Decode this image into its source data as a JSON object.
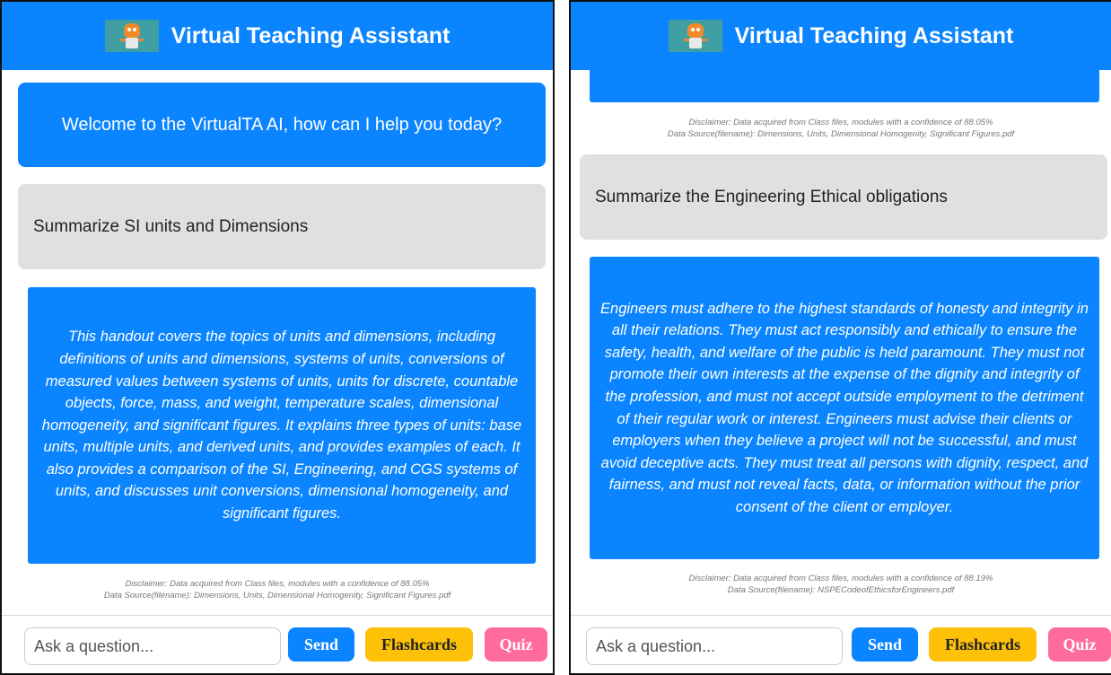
{
  "app": {
    "title": "Virtual Teaching Assistant"
  },
  "left": {
    "welcome": "Welcome to the VirtualTA AI, how can I help you today?",
    "user_message": "Summarize SI units and Dimensions",
    "bot_answer": "This handout covers the topics of units and dimensions, including definitions of units and dimensions, systems of units, conversions of measured values between systems of units, units for discrete, countable objects, force, mass, and weight, temperature scales, dimensional homogeneity, and significant figures. It explains three types of units: base units, multiple units, and derived units, and provides examples of each. It also provides a comparison of the SI, Engineering, and CGS systems of units, and discusses unit conversions, dimensional homogeneity, and significant figures.",
    "disclaimer": "Disclaimer: Data acquired from Class files, modules with a confidence of 88.05%",
    "source": "Data Source(filename): Dimensions, Units, Dimensional Homogenity, Significant Figures.pdf"
  },
  "right": {
    "prev_disclaimer": "Disclaimer: Data acquired from Class files, modules with a confidence of 88.05%",
    "prev_source": "Data Source(filename): Dimensions, Units, Dimensional Homogenity, Significant Figures.pdf",
    "user_message": "Summarize the Engineering Ethical obligations",
    "bot_answer": "Engineers must adhere to the highest standards of honesty and integrity in all their relations. They must act responsibly and ethically to ensure the safety, health, and welfare of the public is held paramount. They must not promote their own interests at the expense of the dignity and integrity of the profession, and must not accept outside employment to the detriment of their regular work or interest. Engineers must advise their clients or employers when they believe a project will not be successful, and must avoid deceptive acts. They must treat all persons with dignity, respect, and fairness, and must not reveal facts, data, or information without the prior consent of the client or employer.",
    "disclaimer": "Disclaimer: Data acquired from Class files, modules with a confidence of 88.19%",
    "source": "Data Source(filename): NSPECodeofEthicsforEngineers.pdf"
  },
  "input": {
    "placeholder": "Ask a question...",
    "send_label": "Send",
    "flashcards_label": "Flashcards",
    "quiz_label": "Quiz"
  },
  "colors": {
    "primary": "#0a84ff",
    "user_bubble": "#e0e0e0",
    "flashcards": "#ffc107",
    "quiz": "#ff6b9d"
  },
  "icons": {
    "logo": "robot-logo-icon"
  }
}
